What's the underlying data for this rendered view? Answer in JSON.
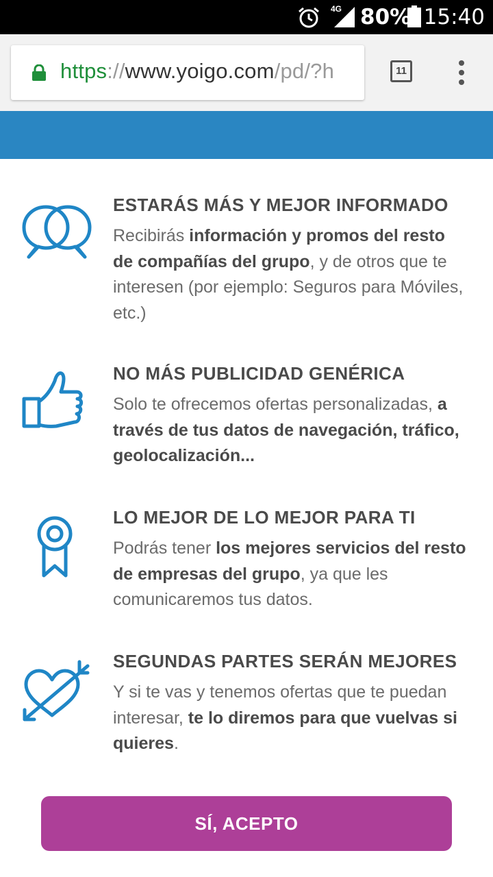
{
  "status_bar": {
    "network": "4G",
    "battery_percent": "80%",
    "time": "15:40"
  },
  "browser": {
    "url_scheme": "https",
    "url_separator": "://",
    "url_host": "www.yoigo.com",
    "url_path": "/pd/?h",
    "tab_count": "11"
  },
  "colors": {
    "banner": "#2a86c2",
    "accent_button": "#ad3f98",
    "icon_blue": "#1f86c6"
  },
  "benefits": [
    {
      "icon": "chat-bubbles-icon",
      "title": "ESTARÁS MÁS Y MEJOR INFORMADO",
      "text_1": "Recibirás ",
      "bold_1": "información y promos del resto de compañías del grupo",
      "text_2": ", y de otros que te interesen (por ejemplo: Seguros para Móviles, etc.)"
    },
    {
      "icon": "thumbs-up-icon",
      "title": "NO MÁS PUBLICIDAD GENÉRICA",
      "text_1": "Solo te ofrecemos ofertas personalizadas, ",
      "bold_1": "a través de tus datos de navegación, tráfico, geolocalización...",
      "text_2": ""
    },
    {
      "icon": "award-ribbon-icon",
      "title": "LO MEJOR DE LO MEJOR PARA TI",
      "text_1": "Podrás tener ",
      "bold_1": "los mejores servicios del resto de empresas del grupo",
      "text_2": ", ya que les comunicaremos tus datos."
    },
    {
      "icon": "heart-arrow-icon",
      "title": "SEGUNDAS PARTES SERÁN MEJORES",
      "text_1": "Y si te vas y tenemos ofertas que te puedan interesar, ",
      "bold_1": "te lo diremos para que vuelvas si quieres",
      "text_2": "."
    }
  ],
  "accept_button": "SÍ, ACEPTO"
}
